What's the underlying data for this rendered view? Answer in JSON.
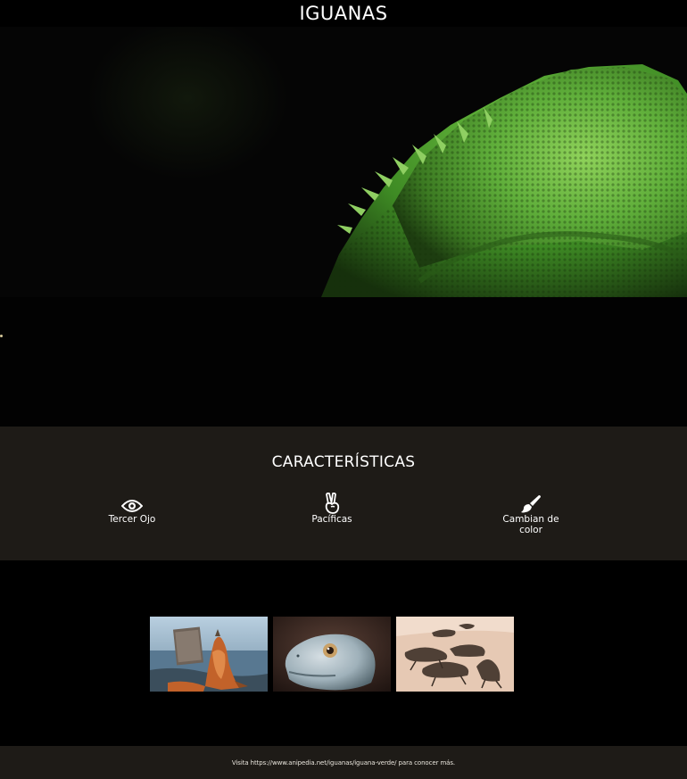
{
  "header": {
    "title": "IGUANAS"
  },
  "features": {
    "title": "CARACTERÍSTICAS",
    "items": [
      {
        "icon": "eye-icon",
        "label": "Tercer Ojo"
      },
      {
        "icon": "peace-hand-icon",
        "label": "Pacíficas"
      },
      {
        "icon": "paint-brush-icon",
        "label": "Cambian de color"
      }
    ]
  },
  "gallery": {
    "images": [
      {
        "name": "iguana-on-beach-photo"
      },
      {
        "name": "iguana-head-closeup-photo"
      },
      {
        "name": "marine-iguanas-group-photo"
      }
    ]
  },
  "footer": {
    "text": "Visita https://www.anipedia.net/iguanas/iguana-verde/ para conocer más."
  },
  "colors": {
    "background": "#000000",
    "section": "#1e1b17",
    "text": "#ffffff",
    "iguana_green": "#5fae3a"
  }
}
